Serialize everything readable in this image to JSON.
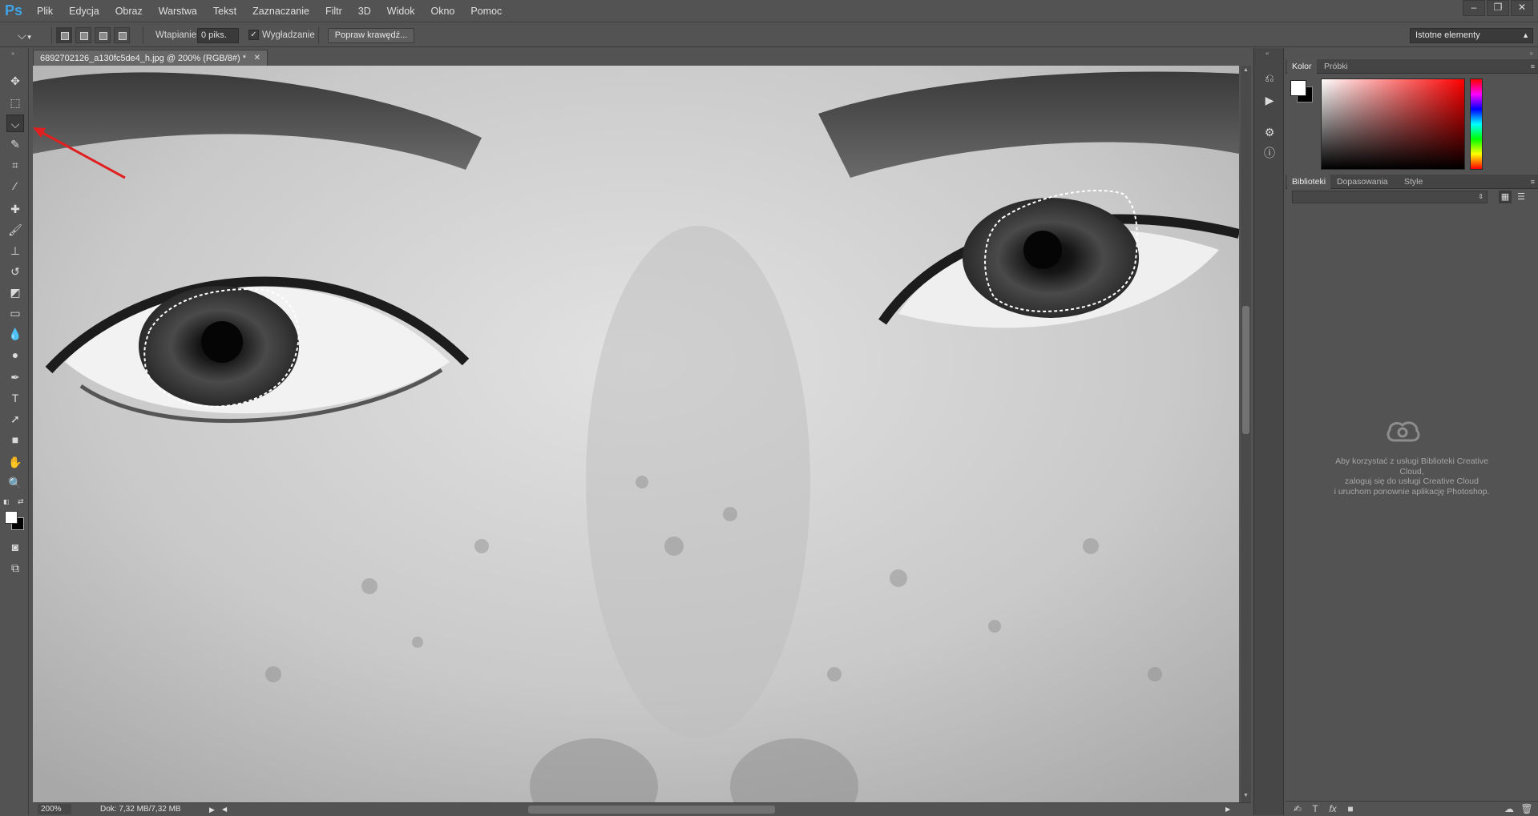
{
  "app": {
    "logo": "Ps"
  },
  "menu": [
    "Plik",
    "Edycja",
    "Obraz",
    "Warstwa",
    "Tekst",
    "Zaznaczanie",
    "Filtr",
    "3D",
    "Widok",
    "Okno",
    "Pomoc"
  ],
  "options": {
    "feather_label": "Wtapianie:",
    "feather_value": "0 piks.",
    "antialias_label": "Wygładzanie",
    "antialias_checked": true,
    "refine_edge": "Popraw krawędź...",
    "workspace": "Istotne elementy"
  },
  "document": {
    "tab_title": "6892702126_a130fc5de4_h.jpg @ 200% (RGB/8#) *",
    "zoom": "200%",
    "doc_info": "Dok: 7,32 MB/7,32 MB"
  },
  "panels": {
    "color_tabs": [
      "Kolor",
      "Próbki"
    ],
    "library_tabs": [
      "Biblioteki",
      "Dopasowania",
      "Style"
    ],
    "cc_message": [
      "Aby korzystać z usługi Biblioteki Creative",
      "Cloud,",
      "zaloguj się do usługi Creative Cloud",
      "i uruchom ponownie aplikację Photoshop."
    ]
  },
  "colors": {
    "foreground": "#ffffff",
    "background": "#000000",
    "accent": "#3fa3e6",
    "annotation_arrow": "#e02020"
  }
}
